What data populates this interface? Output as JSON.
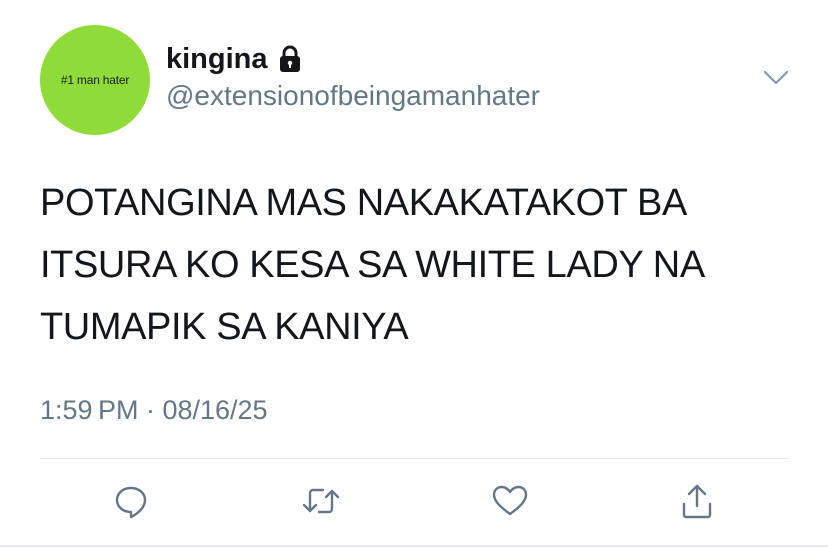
{
  "tweet": {
    "avatar_text": "#1 man hater",
    "display_name": "kingina",
    "handle": "@extensionofbeingamanhater",
    "text": "POTANGINA MAS NAKAKATAKOT BA\nITSURA KO KESA SA WHITE LADY NA\nTUMAPIK SA KANIYA",
    "time": "1:59 PM",
    "date": "08/16/25",
    "timestamp_display": "1:59 PM · 08/16/25"
  },
  "icons": {
    "lock": "lock-icon",
    "chevron": "chevron-down-icon",
    "reply": "reply-icon",
    "retweet": "retweet-icon",
    "like": "heart-icon",
    "share": "share-icon"
  },
  "colors": {
    "avatar_bg": "#8fdb3a",
    "name_text": "#14171a",
    "secondary_text": "#657786",
    "divider": "#e1e8ed",
    "icon": "#657786"
  }
}
